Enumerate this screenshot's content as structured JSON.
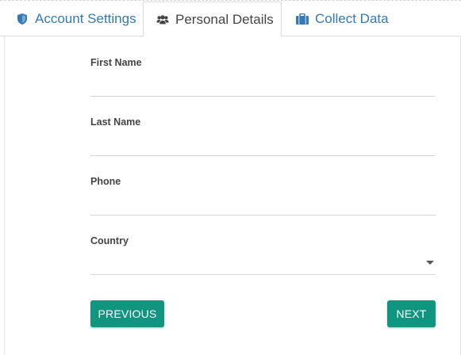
{
  "tabs": [
    {
      "label": "Account Settings",
      "icon": "shield-icon"
    },
    {
      "label": "Personal Details",
      "icon": "users-icon",
      "active": true
    },
    {
      "label": "Collect Data",
      "icon": "briefcase-icon"
    }
  ],
  "form": {
    "first_name": {
      "label": "First Name",
      "value": ""
    },
    "last_name": {
      "label": "Last Name",
      "value": ""
    },
    "phone": {
      "label": "Phone",
      "value": ""
    },
    "country": {
      "label": "Country",
      "value": ""
    }
  },
  "buttons": {
    "previous": "PREVIOUS",
    "next": "NEXT"
  },
  "colors": {
    "tab_link": "#337ab7",
    "button": "#0f9580"
  }
}
